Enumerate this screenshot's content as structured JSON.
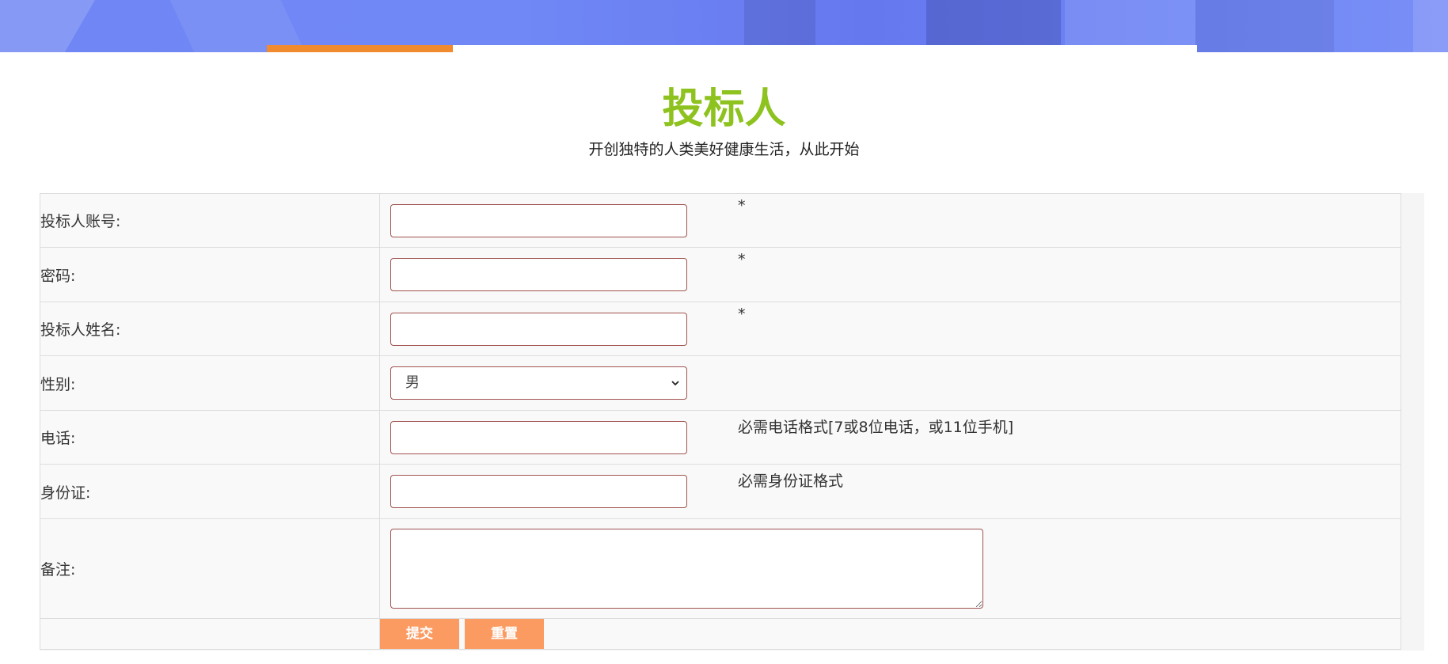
{
  "page": {
    "title": "投标人",
    "subtitle": "开创独特的人类美好健康生活，从此开始"
  },
  "colors": {
    "title_green": "#8dc21f",
    "nav_active": "#f28a2e",
    "button_orange": "#fb9b62",
    "input_border": "#a0524e",
    "banner_blue": "#6f86f4"
  },
  "form": {
    "account": {
      "label": "投标人账号:",
      "value": "",
      "marker": "*"
    },
    "password": {
      "label": "密码:",
      "value": "",
      "marker": "*"
    },
    "name": {
      "label": "投标人姓名:",
      "value": "",
      "marker": "*"
    },
    "gender": {
      "label": "性别:",
      "selected": "男",
      "icon": "chevron-down-icon"
    },
    "phone": {
      "label": "电话:",
      "value": "",
      "hint": "必需电话格式[7或8位电话，或11位手机]"
    },
    "id_card": {
      "label": "身份证:",
      "value": "",
      "hint": "必需身份证格式"
    },
    "remark": {
      "label": "备注:",
      "value": ""
    },
    "buttons": {
      "submit": "提交",
      "reset": "重置"
    }
  }
}
